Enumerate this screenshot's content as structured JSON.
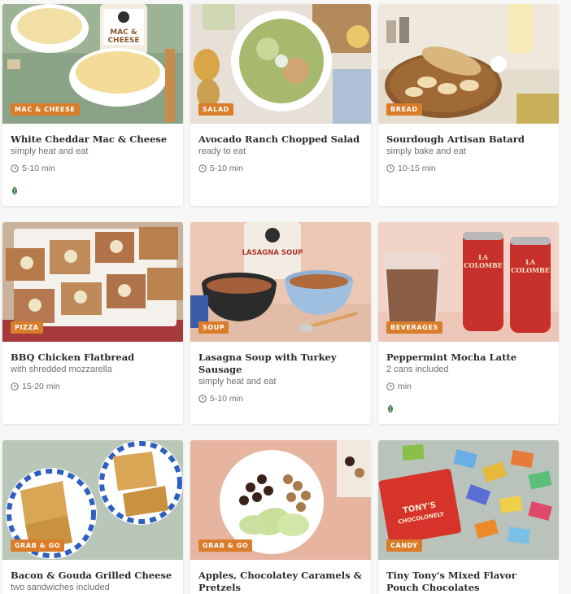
{
  "products": [
    {
      "category": "MAC & CHEESE",
      "title": "White Cheddar Mac & Cheese",
      "subtitle": "simply heat and eat",
      "time": "5-10 min",
      "leaf_icon": true
    },
    {
      "category": "SALAD",
      "title": "Avocado Ranch Chopped Salad",
      "subtitle": "ready to eat",
      "time": "5-10 min",
      "leaf_icon": false
    },
    {
      "category": "BREAD",
      "title": "Sourdough Artisan Batard",
      "subtitle": "simply bake and eat",
      "time": "10-15 min",
      "leaf_icon": false
    },
    {
      "category": "PIZZA",
      "title": "BBQ Chicken Flatbread",
      "subtitle": "with shredded mozzarella",
      "time": "15-20 min",
      "leaf_icon": false
    },
    {
      "category": "SOUP",
      "title": "Lasagna Soup with Turkey Sausage",
      "subtitle": "simply heat and eat",
      "time": "5-10 min",
      "leaf_icon": false
    },
    {
      "category": "BEVERAGES",
      "title": "Peppermint Mocha Latte",
      "subtitle": "2 cans included",
      "time": "min",
      "leaf_icon": true
    },
    {
      "category": "GRAB & GO",
      "title": "Bacon & Gouda Grilled Cheese",
      "subtitle": "two sandwiches included",
      "time": "",
      "leaf_icon": false
    },
    {
      "category": "GRAB & GO",
      "title": "Apples, Chocolatey Caramels & Pretzels",
      "subtitle": "",
      "time": "",
      "leaf_icon": false
    },
    {
      "category": "CANDY",
      "title": "Tiny Tony's Mixed Flavor Pouch Chocolates",
      "subtitle": "",
      "time": "",
      "leaf_icon": false
    }
  ],
  "product_images": [
    {
      "label": "FAMILY MAC & CHEESE"
    },
    {
      "label": ""
    },
    {
      "label": ""
    },
    {
      "label": ""
    },
    {
      "label": "LASAGNA SOUP"
    },
    {
      "label": "LA COLOMBE"
    },
    {
      "label": ""
    },
    {
      "label": ""
    },
    {
      "label": "TONY'S CHOCOLONELY"
    }
  ],
  "colors": {
    "badge": "#d97d2b",
    "leaf": "#3f7a4a",
    "text": "#2b2b2b",
    "muted": "#6f6f6f"
  },
  "icons": {
    "time": "clock-icon",
    "vegetarian": "leaf-icon"
  }
}
